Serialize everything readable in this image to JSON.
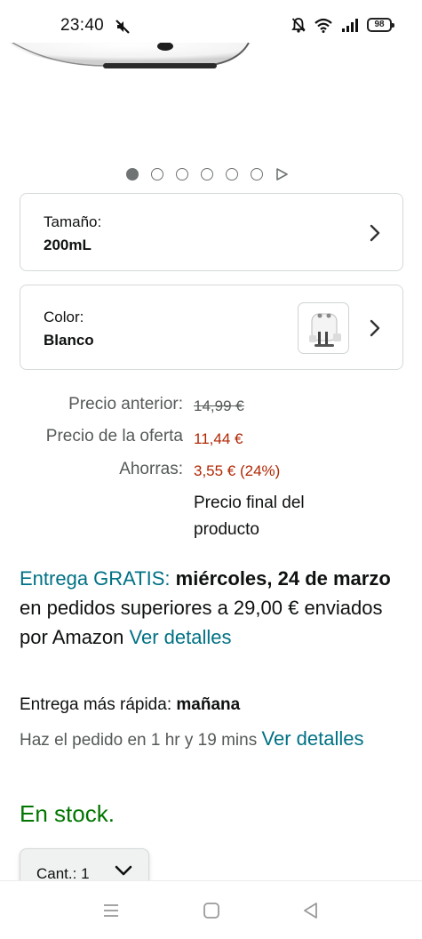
{
  "status_bar": {
    "time": "23:40",
    "battery": "98",
    "icons": [
      "mute-icon",
      "alarm-off-icon",
      "wifi-icon",
      "signal-icon",
      "battery-icon"
    ]
  },
  "carousel": {
    "total_dots": 6,
    "active_index": 0,
    "icons": [
      "dot-icon",
      "play-icon"
    ]
  },
  "size_option": {
    "label": "Tamaño:",
    "value": "200mL"
  },
  "color_option": {
    "label": "Color:",
    "value": "Blanco"
  },
  "prices": {
    "previous_label": "Precio anterior:",
    "previous_value": "14,99 €",
    "offer_label": "Precio de la oferta",
    "offer_value": "11,44 €",
    "savings_label": "Ahorras:",
    "savings_value": "3,55 € (24%)",
    "final_note": "Precio final del producto"
  },
  "delivery": {
    "free_label": "Entrega GRATIS:",
    "date": "miércoles, 24 de marzo",
    "condition": "en pedidos superiores a 29,00 € enviados por Amazon",
    "link": "Ver detalles"
  },
  "fast_delivery": {
    "label": "Entrega más rápida:",
    "value": "mañana"
  },
  "order_by": {
    "text": "Haz el pedido en 1 hr y 19 mins",
    "link": "Ver detalles"
  },
  "stock": "En stock.",
  "quantity": {
    "label": "Cant.:",
    "value": "1"
  },
  "colors": {
    "teal_link": "#007185",
    "price_red": "#b12704",
    "in_stock_green": "#007600",
    "secondary_text": "#565959"
  }
}
